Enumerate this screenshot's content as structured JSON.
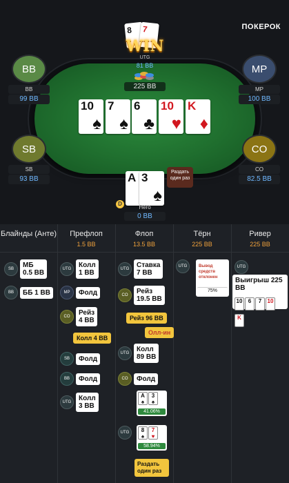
{
  "brand": "ПОКЕРОК",
  "win_text": "WIN",
  "seats": {
    "bb": {
      "avatar": "BB",
      "pos": "BB",
      "stack": "99 BB"
    },
    "mp": {
      "avatar": "MP",
      "pos": "MP",
      "stack": "100 BB"
    },
    "sb": {
      "avatar": "SB",
      "pos": "SB",
      "stack": "93 BB"
    },
    "co": {
      "avatar": "CO",
      "pos": "CO",
      "stack": "82.5 BB"
    },
    "utg": {
      "pos": "UTG",
      "stack": "81 BB",
      "cards": [
        {
          "rank": "8",
          "suit": "♠"
        },
        {
          "rank": "7",
          "suit": "♥"
        }
      ]
    },
    "hero": {
      "pos": "Hero",
      "stack": "0 BB",
      "cards": [
        {
          "rank": "A",
          "suit": "♠"
        },
        {
          "rank": "3",
          "suit": "♠"
        }
      ],
      "bubble": "Раздать один раз",
      "dealer": "D"
    }
  },
  "pot": "225 BB",
  "board": [
    {
      "rank": "10",
      "suit": "♠",
      "color": "black"
    },
    {
      "rank": "7",
      "suit": "♠",
      "color": "black"
    },
    {
      "rank": "6",
      "suit": "♣",
      "color": "black"
    },
    {
      "rank": "10",
      "suit": "♥",
      "color": "red"
    },
    {
      "rank": "K",
      "suit": "♦",
      "color": "red"
    }
  ],
  "history": {
    "headers": [
      {
        "name": "Блайнды (Анте)",
        "amt": ""
      },
      {
        "name": "Префлоп",
        "amt": "1.5 BB"
      },
      {
        "name": "Флоп",
        "amt": "13.5 BB"
      },
      {
        "name": "Тёрн",
        "amt": "225 BB"
      },
      {
        "name": "Ривер",
        "amt": "225 BB"
      }
    ],
    "blinds": [
      {
        "pos": "SB",
        "line1": "МБ",
        "line2": "0.5 BB"
      },
      {
        "pos": "BB",
        "line1": "ББ 1 BB",
        "line2": ""
      }
    ],
    "preflop": [
      {
        "pos": "UTG",
        "line1": "Колл",
        "line2": "1 BB"
      },
      {
        "pos": "MP",
        "line1": "Фолд",
        "line2": ""
      },
      {
        "pos": "CO",
        "line1": "Рейз",
        "line2": "4 BB"
      },
      {
        "pos": "SB",
        "line1": "Фолд",
        "line2": ""
      },
      {
        "pos": "BB",
        "line1": "Фолд",
        "line2": ""
      },
      {
        "pos": "UTG",
        "line1": "Колл",
        "line2": "3 BB"
      }
    ],
    "preflop_tag": "Колл 4 BB",
    "flop": [
      {
        "pos": "UTG",
        "line1": "Ставка",
        "line2": "7 BB"
      },
      {
        "pos": "CO",
        "line1": "Рейз",
        "line2": "19.5 BB"
      },
      {
        "pos": "UTG",
        "line1": "Колл",
        "line2": "89 BB"
      },
      {
        "pos": "CO",
        "line1": "Фолд",
        "line2": ""
      }
    ],
    "flop_tag_raise": "Рейз 96 BB",
    "flop_tag_allin": "Олл-ин",
    "equity_hero": {
      "cards": [
        {
          "rank": "A",
          "suit": "♠"
        },
        {
          "rank": "3",
          "suit": "♠"
        }
      ],
      "pct": "41.06%"
    },
    "equity_utg": {
      "pos": "UTG",
      "cards": [
        {
          "rank": "8",
          "suit": "♠"
        },
        {
          "rank": "7",
          "suit": "♥"
        }
      ],
      "pct": "58.94%"
    },
    "flop_tag_deal": "Раздать один раз",
    "turn": {
      "pos": "UTG",
      "text": "Вывод средств отклонен",
      "pct": "75%"
    },
    "river": {
      "pos": "UTG",
      "text": "Выигрыш 225 BB",
      "cards": [
        "10",
        "6",
        "7",
        "10",
        "K"
      ]
    }
  }
}
